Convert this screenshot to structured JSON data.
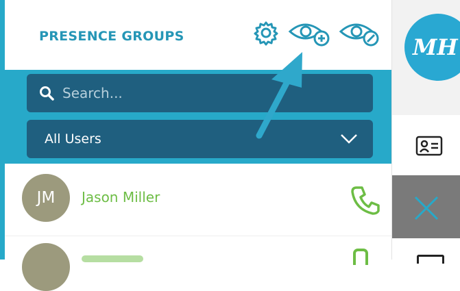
{
  "header": {
    "title": "PRESENCE GROUPS",
    "icons": [
      "gear-icon",
      "add-watch-icon",
      "remove-watch-icon"
    ]
  },
  "search": {
    "placeholder": "Search..."
  },
  "filter": {
    "selected": "All Users"
  },
  "users": [
    {
      "initials": "JM",
      "name": "Jason  Miller",
      "status_icon": "phone-icon"
    }
  ],
  "profile": {
    "initials": "MH"
  },
  "colors": {
    "accent": "#27a9c9",
    "input_bg": "#1f5f7f",
    "title": "#2596b6",
    "status_green": "#6dbd45",
    "avatar_bg": "#9c9a7d",
    "close_bg": "#7a7a7a"
  }
}
